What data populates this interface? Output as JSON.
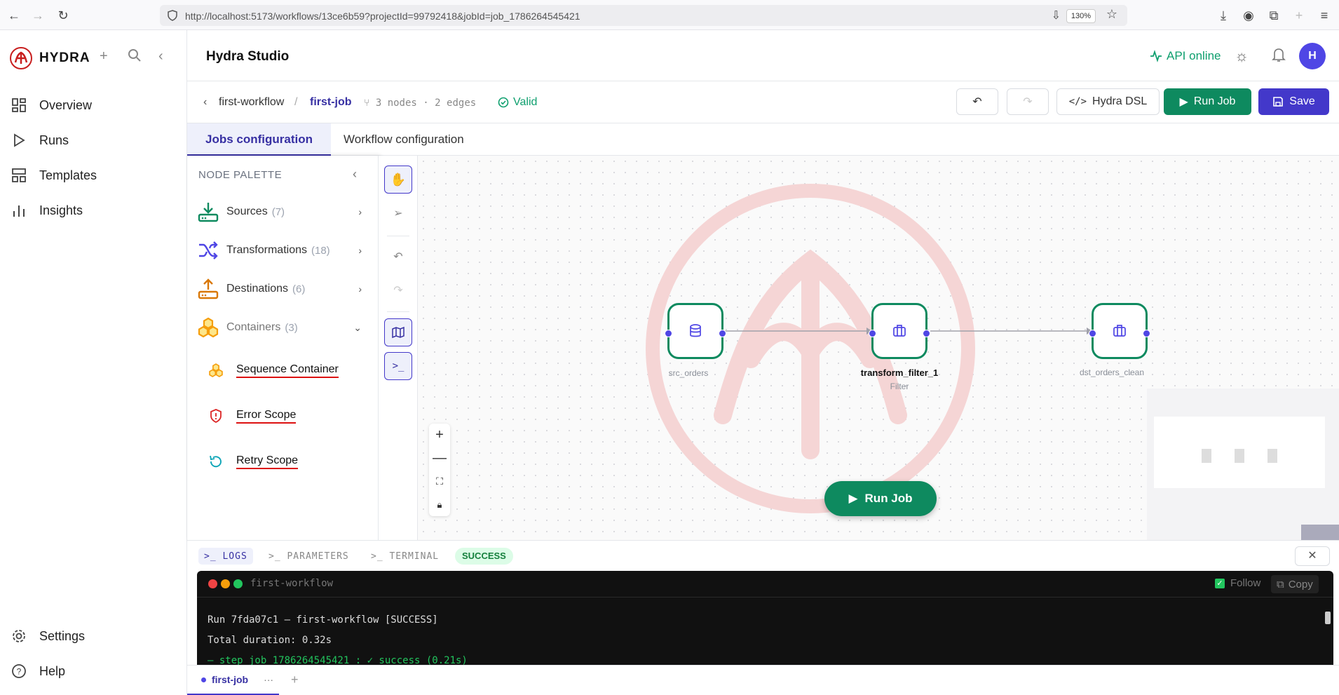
{
  "browser": {
    "url": "http://localhost:5173/workflows/13ce6b59?projectId=99792418&jobId=job_1786264545421",
    "zoom": "130%"
  },
  "app": {
    "name": "HYDRA",
    "studio_title": "Hydra Studio",
    "api_status": "API online",
    "avatar_initial": "H"
  },
  "nav": {
    "items": [
      {
        "label": "Overview",
        "icon": "grid-icon"
      },
      {
        "label": "Runs",
        "icon": "play-icon"
      },
      {
        "label": "Templates",
        "icon": "template-icon"
      },
      {
        "label": "Insights",
        "icon": "bar-chart-icon"
      }
    ],
    "bottom": [
      {
        "label": "Settings",
        "icon": "gear-icon"
      },
      {
        "label": "Help",
        "icon": "help-icon"
      }
    ]
  },
  "subbar": {
    "workflow": "first-workflow",
    "separator": "/",
    "job": "first-job",
    "nodes": "3 nodes",
    "dot": "·",
    "edges": "2 edges",
    "valid": "Valid",
    "dsl_label": "Hydra DSL",
    "run_label": "Run Job",
    "save_label": "Save"
  },
  "tabs": [
    {
      "label": "Jobs configuration",
      "active": true
    },
    {
      "label": "Workflow configuration",
      "active": false
    }
  ],
  "palette": {
    "title": "NODE PALETTE",
    "categories": [
      {
        "label": "Sources",
        "count": "(7)",
        "color": "#0e8a5f"
      },
      {
        "label": "Transformations",
        "count": "(18)",
        "color": "#4f46e5"
      },
      {
        "label": "Destinations",
        "count": "(6)",
        "color": "#d97706"
      },
      {
        "label": "Containers",
        "count": "(3)",
        "color": "#f59e0b"
      }
    ],
    "containers": [
      {
        "label": "Sequence Container",
        "icon": "hexagons-icon"
      },
      {
        "label": "Error Scope",
        "icon": "shield-alert-icon"
      },
      {
        "label": "Retry Scope",
        "icon": "retry-icon"
      }
    ]
  },
  "nodes": [
    {
      "label": "src_orders",
      "subtitle": "",
      "icon": "database-icon"
    },
    {
      "label": "transform_filter_1",
      "subtitle": "Filter",
      "icon": "briefcase-icon"
    },
    {
      "label": "dst_orders_clean",
      "subtitle": "",
      "icon": "briefcase-icon"
    }
  ],
  "canvas": {
    "run_label": "Run Job"
  },
  "bottom": {
    "tabs": [
      {
        "label": "LOGS",
        "active": true
      },
      {
        "label": "PARAMETERS",
        "active": false
      },
      {
        "label": "TERMINAL",
        "active": false
      }
    ],
    "status": "SUCCESS",
    "terminal_title": "first-workflow",
    "follow_label": "Follow",
    "copy_label": "Copy",
    "log_lines": [
      "Run 7fda07c1 — first-workflow [SUCCESS]",
      "Total duration: 0.32s",
      "— step job_1786264545421 : ✓ success (0.21s)"
    ]
  },
  "filetab": {
    "label": "first-job",
    "more": "···",
    "add": "+"
  },
  "colors": {
    "accent": "#4338ca",
    "success": "#0e8a5f",
    "edge": "#a1a1aa"
  }
}
